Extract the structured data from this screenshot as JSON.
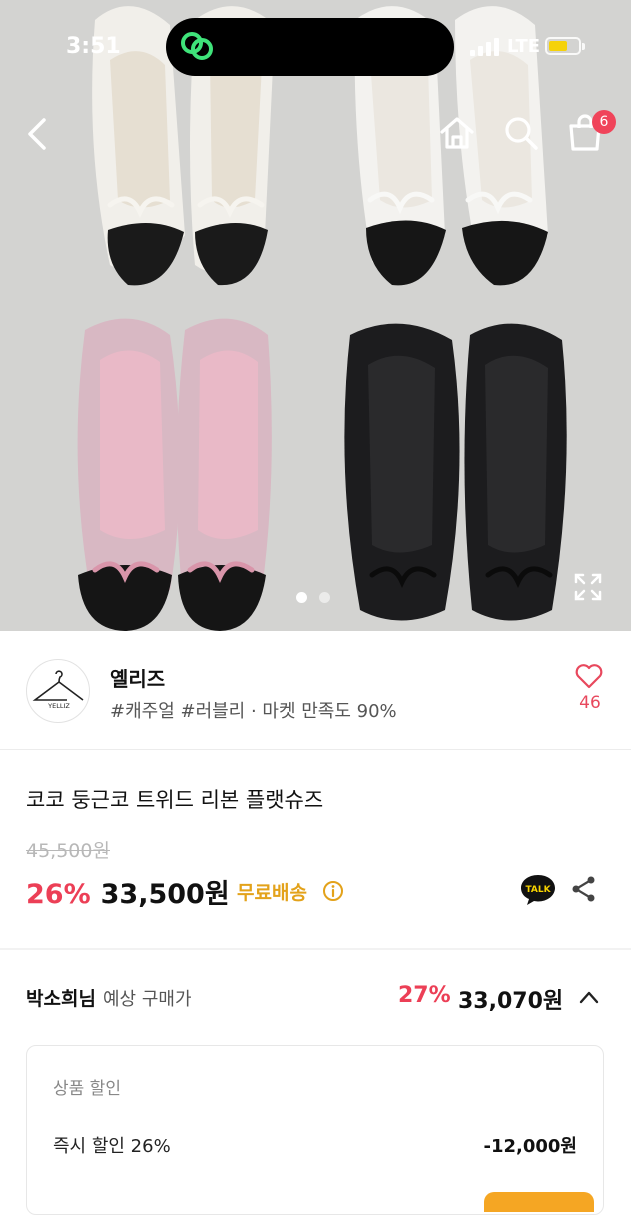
{
  "status_bar": {
    "time": "3:51",
    "network": "LTE"
  },
  "nav": {
    "cart_count": "6"
  },
  "gallery": {
    "dots": [
      "active",
      "inactive"
    ]
  },
  "store": {
    "logo_text": "YELLIZ",
    "name": "옐리즈",
    "tags": "#캐주얼 #러블리 · 마켓 만족도 90%",
    "likes": "46"
  },
  "product": {
    "title": "코코 둥근코 트위드 리본 플랫슈즈",
    "original_price": "45,500원",
    "discount": "26%",
    "price": "33,500원",
    "shipping": "무료배송",
    "talk_label": "TALK"
  },
  "expected": {
    "user_name": "박소희님",
    "label": "예상 구매가",
    "discount": "27%",
    "price": "33,070원"
  },
  "discount_card": {
    "title": "상품 할인",
    "rows": [
      {
        "label": "즉시 할인 26%",
        "value": "-12,000원"
      }
    ]
  },
  "colors": {
    "accent": "#ec3f56",
    "shipping": "#e3a21a",
    "badge": "#f0445a"
  }
}
